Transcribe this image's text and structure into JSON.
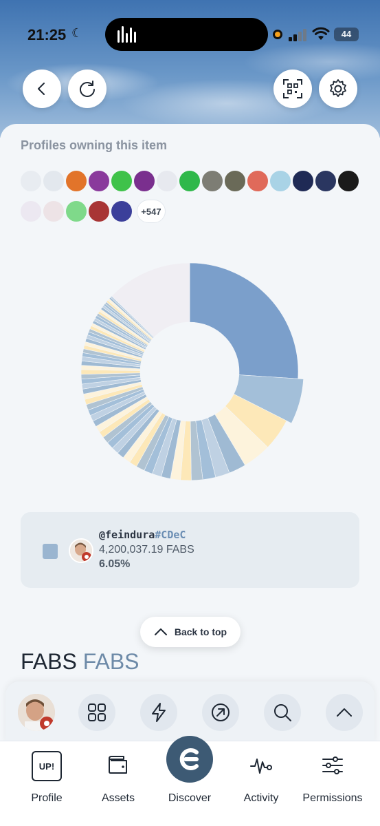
{
  "status": {
    "time": "21:25",
    "battery": "44"
  },
  "header": {
    "back_icon": "chevron-left-icon",
    "refresh_icon": "refresh-icon",
    "qr_icon": "qr-scan-icon",
    "settings_icon": "gear-icon"
  },
  "owners": {
    "title": "Profiles owning this item",
    "more_count": "+547"
  },
  "chart_data": {
    "type": "pie",
    "title": "",
    "hole": "donut",
    "colors": [
      "#7b9fcb",
      "#a3bfd9",
      "#b0c3d2",
      "#fde8b8",
      "#fdf3dc",
      "#9fbad3",
      "#bfd1e3",
      "#f0eef3"
    ],
    "values": [
      24.5,
      6.05,
      4.5,
      4.0,
      2.4,
      2.0,
      1.8,
      1.6,
      1.5,
      1.4,
      1.3,
      1.3,
      1.2,
      1.2,
      1.1,
      1.1,
      1.0,
      1.0,
      1.0,
      0.95,
      0.9,
      0.9,
      0.85,
      0.85,
      0.8,
      0.8,
      0.75,
      0.75,
      0.7,
      0.7,
      0.7,
      0.65,
      0.65,
      0.6,
      0.6,
      0.6,
      0.55,
      0.55,
      0.5,
      0.5,
      0.5,
      0.5,
      0.45,
      0.45,
      0.45,
      0.4,
      0.4,
      0.4,
      0.4,
      0.35,
      0.35,
      0.35,
      0.35,
      0.3,
      0.3,
      0.3,
      0.3,
      0.3,
      0.25,
      0.25,
      12.0
    ]
  },
  "holder": {
    "name": "@feindura",
    "tag": "#CDeC",
    "amount": "4,200,037.19 FABS",
    "percent": "6.05%",
    "swatch_color": "#9ab5d0"
  },
  "back_to_top": {
    "label": "Back to top"
  },
  "token": {
    "name": "FABS",
    "symbol": "FABS"
  },
  "quick_actions": {
    "icons": [
      "grid-icon",
      "lightning-icon",
      "arrow-up-right-icon",
      "search-icon",
      "chevron-up-icon"
    ]
  },
  "tabs": [
    {
      "label": "Profile",
      "icon": "up-badge-icon",
      "badge_text": "UP!"
    },
    {
      "label": "Assets",
      "icon": "wallet-icon"
    },
    {
      "label": "Discover",
      "icon": "discover-logo-icon"
    },
    {
      "label": "Activity",
      "icon": "pulse-icon"
    },
    {
      "label": "Permissions",
      "icon": "sliders-icon"
    }
  ]
}
